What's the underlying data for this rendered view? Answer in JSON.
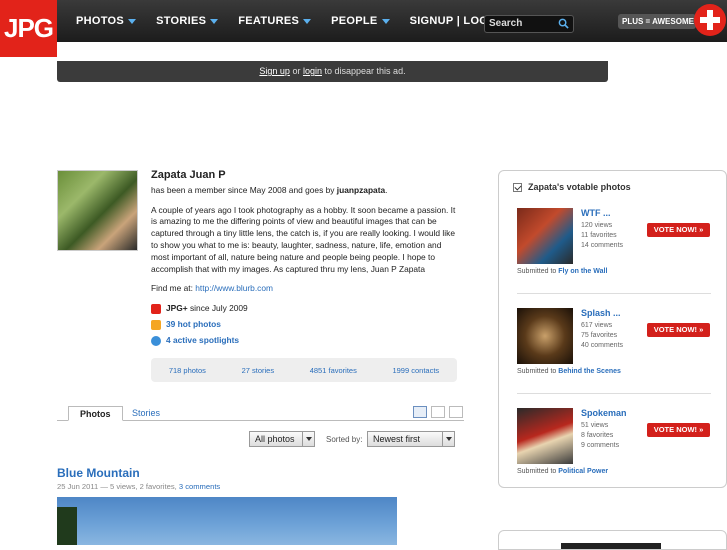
{
  "header": {
    "logo": "JPG",
    "nav": [
      {
        "label": "PHOTOS",
        "has_caret": true
      },
      {
        "label": "STORIES",
        "has_caret": true
      },
      {
        "label": "FEATURES",
        "has_caret": true
      },
      {
        "label": "PEOPLE",
        "has_caret": true
      },
      {
        "label": "SIGNUP | LOGIN",
        "has_caret": false
      }
    ],
    "search_placeholder": "Search",
    "plus_badge": "PLUS = AWESOME"
  },
  "ad": {
    "signup": "Sign up",
    "or": "or",
    "login": "login",
    "suffix": "to disappear this ad."
  },
  "profile": {
    "name": "Zapata Juan P",
    "member_prefix": "has been a member since May 2008 and goes by",
    "username": "juanpzapata",
    "bio": "A couple of years ago I took photography as a hobby. It soon became a passion. It is amazing to me the differing points of view and beautiful images that can be captured through a tiny little lens, the catch is, if you are really looking. I would like to show you what to me is: beauty, laughter, sadness, nature, life, emotion and most important of all, nature being nature and people being people. I hope to accomplish that with my images. As captured thru my lens, Juan P Zapata",
    "find_prefix": "Find me at:",
    "find_url": "http://www.blurb.com",
    "badges": [
      {
        "label": "JPG+",
        "suffix": "since July 2009",
        "color": "#e2231a"
      },
      {
        "label": "39 hot photos",
        "suffix": "",
        "color": "#f5a623"
      },
      {
        "label": "4 active spotlights",
        "suffix": "",
        "color": "#3a8fd9"
      }
    ],
    "stats": [
      "718 photos",
      "27 stories",
      "4851 favorites",
      "1999 contacts"
    ]
  },
  "tabs": {
    "photos": "Photos",
    "stories": "Stories"
  },
  "filters": {
    "type": "All photos",
    "sorted_by": "Sorted by:",
    "sort": "Newest first"
  },
  "post": {
    "title": "Blue Mountain",
    "meta": "25 Jun 2011 — 5 views, 2 favorites,",
    "comments": "3 comments"
  },
  "sidebar": {
    "title": "Zapata's votable photos",
    "vote_label": "VOTE NOW! »",
    "submitted_prefix": "Submitted to",
    "items": [
      {
        "title": "WTF ...",
        "views": "120 views",
        "favorites": "11 favorites",
        "comments": "14 comments",
        "category": "Fly on the Wall"
      },
      {
        "title": "Splash ...",
        "views": "617 views",
        "favorites": "75 favorites",
        "comments": "40 comments",
        "category": "Behind the Scenes"
      },
      {
        "title": "Spokeman",
        "views": "51 views",
        "favorites": "8 favorites",
        "comments": "9 comments",
        "category": "Political Power"
      }
    ]
  }
}
